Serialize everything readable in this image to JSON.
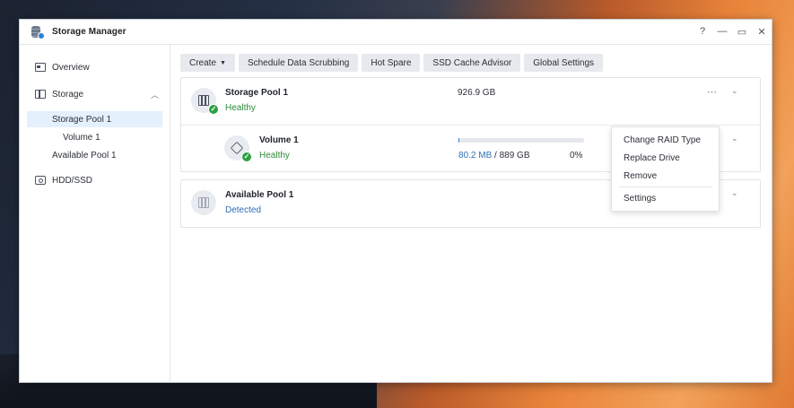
{
  "window": {
    "title": "Storage Manager",
    "controls": {
      "help": "?",
      "minimize": "—",
      "maximize": "▭",
      "close": "✕"
    }
  },
  "sidebar": {
    "overview": "Overview",
    "storage": "Storage",
    "storage_pool": "Storage Pool 1",
    "volume": "Volume 1",
    "available_pool": "Available Pool 1",
    "hdd": "HDD/SSD"
  },
  "toolbar": {
    "create": "Create",
    "schedule": "Schedule Data Scrubbing",
    "hot_spare": "Hot Spare",
    "ssd_cache": "SSD Cache Advisor",
    "global_settings": "Global Settings"
  },
  "pool": {
    "name": "Storage Pool 1",
    "status": "Healthy",
    "size": "926.9 GB"
  },
  "volume": {
    "name": "Volume 1",
    "status": "Healthy",
    "used": "80.2 MB",
    "sep": " / ",
    "total": "889 GB",
    "percent": "0%",
    "usage_fraction": 0.001
  },
  "available": {
    "name": "Available Pool 1",
    "status": "Detected"
  },
  "menu": {
    "change_raid": "Change RAID Type",
    "replace_drive": "Replace Drive",
    "remove": "Remove",
    "settings": "Settings"
  },
  "icons": {
    "more": "⋯",
    "chevron": "⌄",
    "check": "✓"
  },
  "colors": {
    "accent": "#2f7fd8",
    "healthy": "#2e8b3a",
    "selected_bg": "#e4f0fb"
  }
}
